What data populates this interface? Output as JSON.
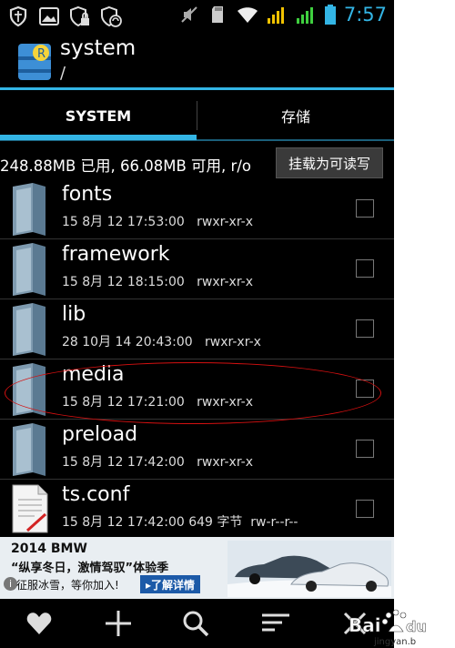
{
  "status_bar": {
    "time": "7:57",
    "left_icons": [
      "shield-icon",
      "picture-icon",
      "lock-shield-icon",
      "lock-sync-icon"
    ],
    "right_icons": [
      "mute-icon",
      "sd-card-icon",
      "wifi-icon",
      "signal-icon",
      "signal-icon",
      "battery-icon"
    ]
  },
  "app": {
    "title": "system",
    "path": "/"
  },
  "tabs": [
    {
      "label": "SYSTEM",
      "selected": true
    },
    {
      "label": "存储",
      "selected": false
    }
  ],
  "storage_info": "248.88MB 已用, 66.08MB 可用, r/o",
  "mount_button": "挂载为可读写",
  "files": [
    {
      "name": "fonts",
      "date": "15 8月 12 17:53:00",
      "size": "",
      "perms": "rwxr-xr-x",
      "type": "folder"
    },
    {
      "name": "framework",
      "date": "15 8月 12 18:15:00",
      "size": "",
      "perms": "rwxr-xr-x",
      "type": "folder"
    },
    {
      "name": "lib",
      "date": "28 10月 14 20:43:00",
      "size": "",
      "perms": "rwxr-xr-x",
      "type": "folder"
    },
    {
      "name": "media",
      "date": "15 8月 12 17:21:00",
      "size": "",
      "perms": "rwxr-xr-x",
      "type": "folder"
    },
    {
      "name": "preload",
      "date": "15 8月 12 17:42:00",
      "size": "",
      "perms": "rwxr-xr-x",
      "type": "folder"
    },
    {
      "name": "ts.conf",
      "date": "15 8月 12 17:42:00",
      "size": "649 字节",
      "perms": "rw-r--r--",
      "type": "file"
    }
  ],
  "ad": {
    "line1": "2014 BMW",
    "line2": "“纵享冬日，激情驾驭”体验季",
    "line3": "征服冰雪，等你加入!",
    "button": "▸了解详情"
  },
  "bottom_bar": [
    "heart-icon",
    "plus-icon",
    "search-icon",
    "sort-icon",
    "close-icon"
  ],
  "watermark": {
    "brand": "Bai du",
    "site": "jingyan.b"
  },
  "colors": {
    "accent": "#33b5e5",
    "background": "#000000",
    "highlight_circle": "#d51010"
  }
}
